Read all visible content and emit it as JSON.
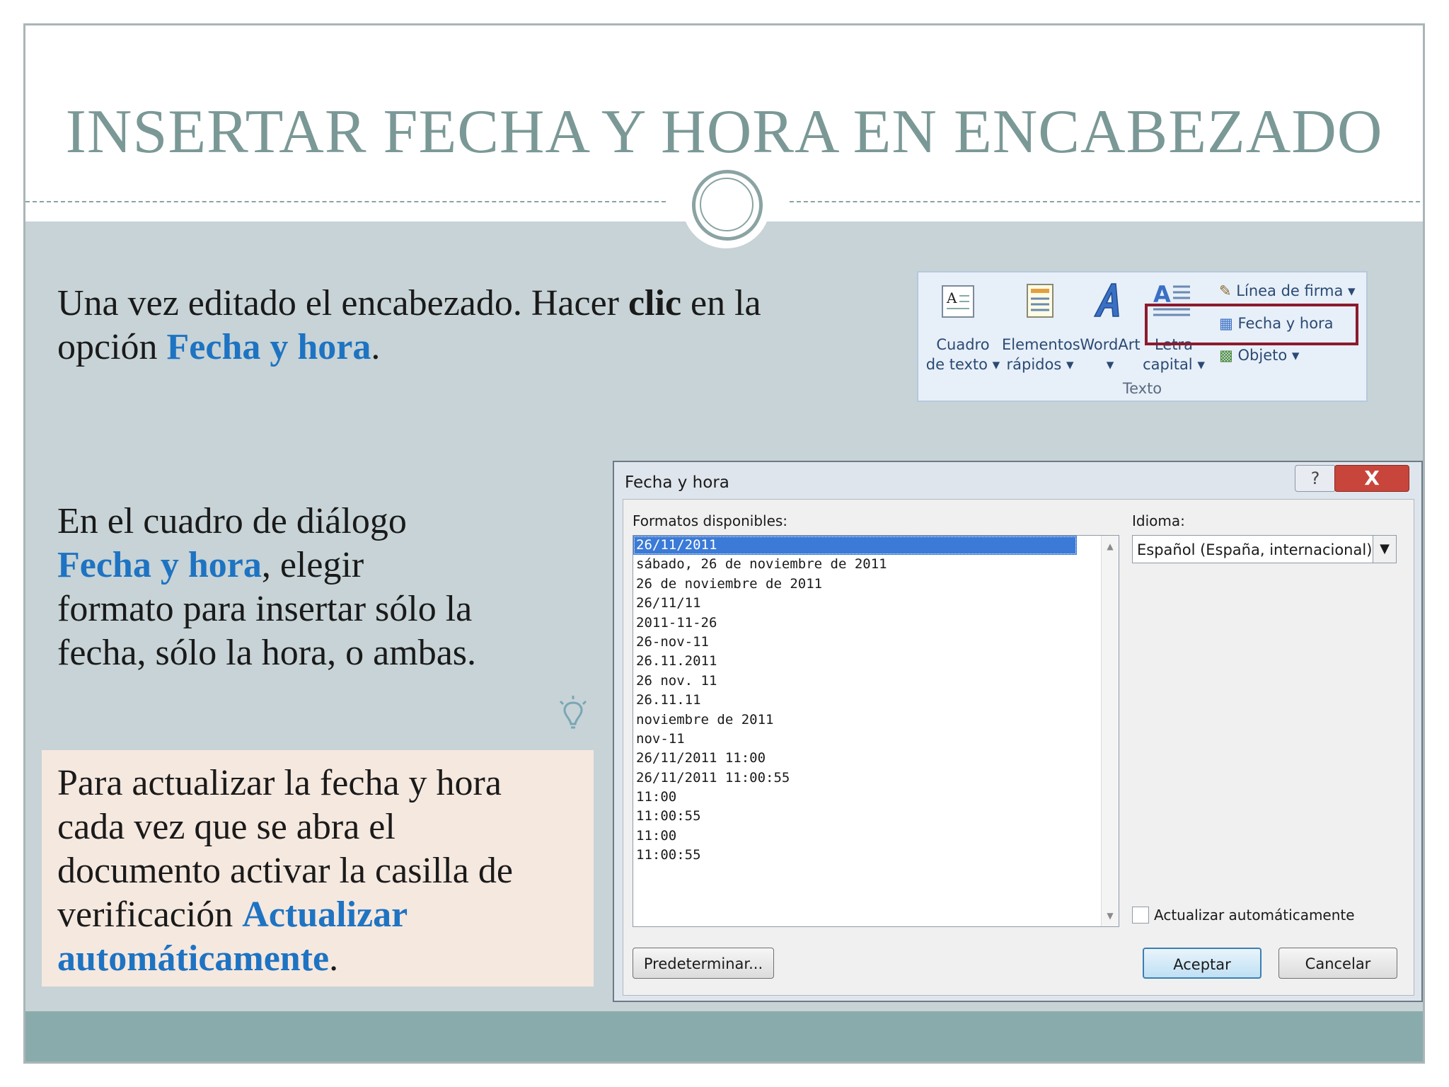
{
  "slide": {
    "title": "INSERTAR FECHA Y HORA EN ENCABEZADO",
    "para1": {
      "a": "Una vez editado el encabezado.  Hacer ",
      "b": "clic",
      "c": " en la",
      "d": "opción ",
      "e": "Fecha y hora",
      "f": "."
    },
    "para2": {
      "a": "En el cuadro de diálogo",
      "b": "Fecha y hora",
      "c": ", elegir",
      "d": "formato para insertar sólo la",
      "e": "fecha, sólo la hora, o ambas."
    },
    "note": {
      "a": "Para actualizar la fecha y hora",
      "b": "cada vez que se abra el",
      "c": "documento activar la casilla de",
      "d": "verificación ",
      "e": "Actualizar",
      "f": "automáticamente",
      "g": "."
    },
    "accent_color": "#1e73c2",
    "title_color": "#7a9896"
  },
  "ribbon": {
    "text_box": {
      "line1": "Cuadro",
      "line2": "de texto ▾"
    },
    "quick_parts": {
      "line1": "Elementos",
      "line2": "rápidos ▾"
    },
    "wordart": {
      "line1": "WordArt",
      "line2": "▾"
    },
    "drop_cap": {
      "line1": "Letra",
      "line2": "capital ▾"
    },
    "signature_line": "Línea de firma ▾",
    "date_time": "Fecha y hora",
    "object": "Objeto ▾",
    "group_label": "Texto"
  },
  "dialog": {
    "title": "Fecha y hora",
    "help": "?",
    "close": "X",
    "formats_label": "Formatos disponibles:",
    "language_label": "Idioma:",
    "language_value": "Español (España, internacional)",
    "formats": [
      "26/11/2011",
      "sábado, 26 de noviembre de 2011",
      "26 de noviembre de 2011",
      "26/11/11",
      "2011-11-26",
      "26-nov-11",
      "26.11.2011",
      "26 nov. 11",
      "26.11.11",
      "noviembre de 2011",
      "nov-11",
      "26/11/2011 11:00",
      "26/11/2011 11:00:55",
      "11:00",
      "11:00:55",
      "11:00",
      "11:00:55"
    ],
    "selected_index": 0,
    "auto_update_label": "Actualizar automáticamente",
    "auto_update_checked": false,
    "default_button": "Predeterminar...",
    "ok_button": "Aceptar",
    "cancel_button": "Cancelar"
  }
}
